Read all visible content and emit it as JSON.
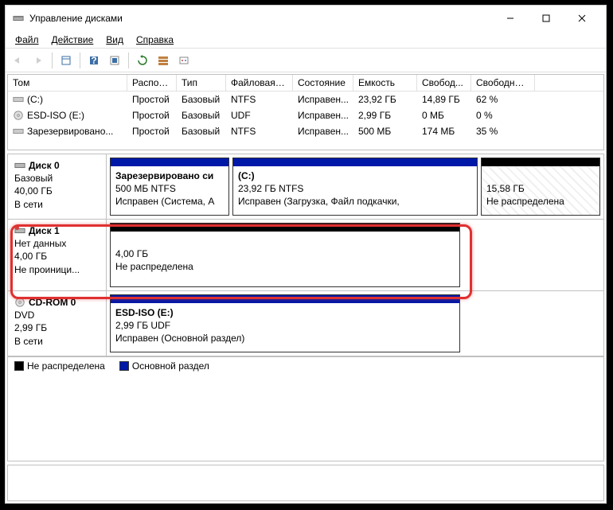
{
  "window": {
    "title": "Управление дисками"
  },
  "menu": {
    "file": "Файл",
    "action": "Действие",
    "view": "Вид",
    "help": "Справка"
  },
  "columns": {
    "volume": "Том",
    "layout": "Располо...",
    "type": "Тип",
    "fs": "Файловая с...",
    "status": "Состояние",
    "capacity": "Емкость",
    "free": "Свобод...",
    "freepct": "Свободно %"
  },
  "volumes": [
    {
      "name": "(C:)",
      "layout": "Простой",
      "type": "Базовый",
      "fs": "NTFS",
      "status": "Исправен...",
      "capacity": "23,92 ГБ",
      "free": "14,89 ГБ",
      "freepct": "62 %"
    },
    {
      "name": "ESD-ISO (E:)",
      "layout": "Простой",
      "type": "Базовый",
      "fs": "UDF",
      "status": "Исправен...",
      "capacity": "2,99 ГБ",
      "free": "0 МБ",
      "freepct": "0 %"
    },
    {
      "name": "Зарезервировано...",
      "layout": "Простой",
      "type": "Базовый",
      "fs": "NTFS",
      "status": "Исправен...",
      "capacity": "500 МБ",
      "free": "174 МБ",
      "freepct": "35 %"
    }
  ],
  "disks": {
    "d0": {
      "name": "Диск 0",
      "type": "Базовый",
      "size": "40,00 ГБ",
      "status": "В сети",
      "p0": {
        "title": "Зарезервировано си",
        "size": "500 МБ NTFS",
        "status": "Исправен (Система, А"
      },
      "p1": {
        "title": "(C:)",
        "size": "23,92 ГБ NTFS",
        "status": "Исправен (Загрузка, Файл подкачки,"
      },
      "p2": {
        "size": "15,58 ГБ",
        "status": "Не распределена"
      }
    },
    "d1": {
      "name": "Диск 1",
      "type": "Нет данных",
      "size": "4,00 ГБ",
      "status": "Не проиници...",
      "p0": {
        "size": "4,00 ГБ",
        "status": "Не распределена"
      }
    },
    "cd0": {
      "name": "CD-ROM 0",
      "type": "DVD",
      "size": "2,99 ГБ",
      "status": "В сети",
      "p0": {
        "title": "ESD-ISO  (E:)",
        "size": "2,99 ГБ UDF",
        "status": "Исправен (Основной раздел)"
      }
    }
  },
  "legend": {
    "unallocated": "Не распределена",
    "primary": "Основной раздел"
  }
}
